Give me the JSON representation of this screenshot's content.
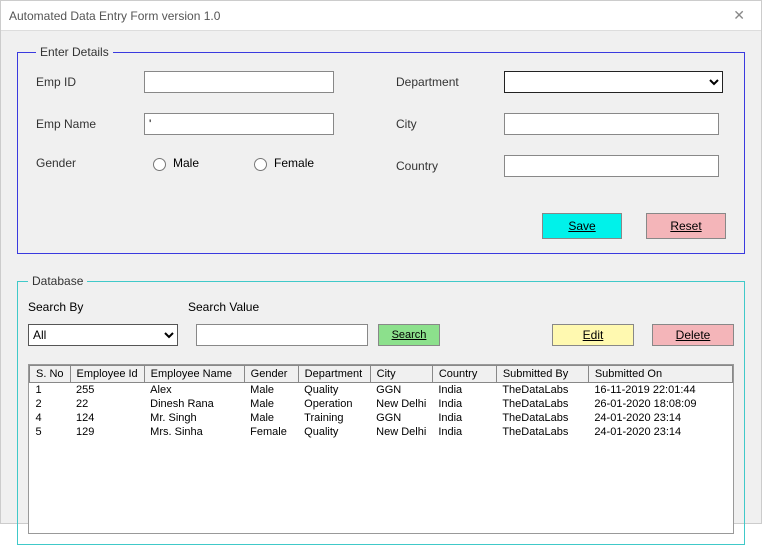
{
  "window": {
    "title": "Automated Data Entry Form version 1.0"
  },
  "details": {
    "legend": "Enter Details",
    "labels": {
      "empId": "Emp ID",
      "empName": "Emp Name",
      "gender": "Gender",
      "department": "Department",
      "city": "City",
      "country": "Country"
    },
    "values": {
      "empId": "",
      "empName": "'",
      "city": "",
      "country": ""
    },
    "radios": {
      "male": "Male",
      "female": "Female"
    },
    "buttons": {
      "save": "Save",
      "reset": "Reset"
    }
  },
  "database": {
    "legend": "Database",
    "labels": {
      "searchBy": "Search By",
      "searchValue": "Search Value"
    },
    "searchBy": {
      "selected": "All"
    },
    "searchValue": "",
    "buttons": {
      "search": "Search",
      "edit": "Edit",
      "delete": "Delete"
    },
    "columns": {
      "sno": "S. No",
      "empId": "Employee Id",
      "empName": "Employee Name",
      "gender": "Gender",
      "department": "Department",
      "city": "City",
      "country": "Country",
      "submittedBy": "Submitted By",
      "submittedOn": "Submitted On"
    },
    "rows": [
      {
        "sno": "1",
        "empId": "255",
        "empName": "Alex",
        "gender": "Male",
        "department": "Quality",
        "city": "GGN",
        "country": "India",
        "submittedBy": "TheDataLabs",
        "submittedOn": "16-11-2019 22:01:44"
      },
      {
        "sno": "2",
        "empId": "22",
        "empName": "Dinesh Rana",
        "gender": "Male",
        "department": "Operation",
        "city": "New Delhi",
        "country": "India",
        "submittedBy": "TheDataLabs",
        "submittedOn": "26-01-2020 18:08:09"
      },
      {
        "sno": "4",
        "empId": "124",
        "empName": "Mr. Singh",
        "gender": "Male",
        "department": "Training",
        "city": "GGN",
        "country": "India",
        "submittedBy": "TheDataLabs",
        "submittedOn": "24-01-2020 23:14"
      },
      {
        "sno": "5",
        "empId": "129",
        "empName": "Mrs. Sinha",
        "gender": "Female",
        "department": "Quality",
        "city": "New Delhi",
        "country": "India",
        "submittedBy": "TheDataLabs",
        "submittedOn": "24-01-2020 23:14"
      }
    ]
  }
}
